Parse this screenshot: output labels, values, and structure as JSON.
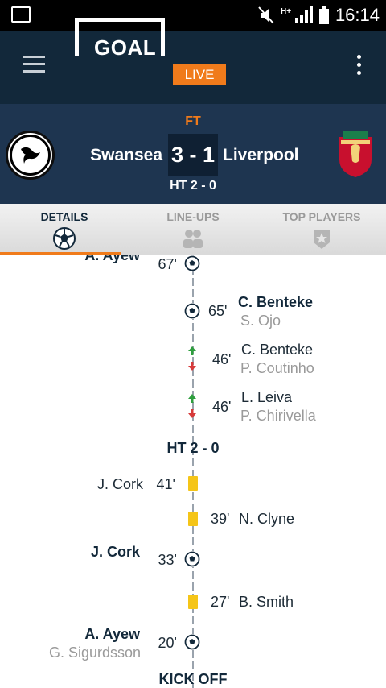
{
  "status_bar": {
    "time": "16:14",
    "icons": [
      "image-icon",
      "mute-icon",
      "hplus-signal-icon",
      "battery-icon"
    ]
  },
  "app_bar": {
    "logo_text": "GOAL",
    "live_label": "LIVE",
    "menu_icon": "hamburger-icon",
    "overflow_icon": "more-vert-icon"
  },
  "match": {
    "status": "FT",
    "home_team": "Swansea",
    "away_team": "Liverpool",
    "score": "3 - 1",
    "half_time": "HT 2 - 0",
    "home_crest": "swansea-crest-icon",
    "away_crest": "liverpool-crest-icon"
  },
  "tabs": [
    {
      "label": "DETAILS",
      "icon": "football-icon",
      "active": true
    },
    {
      "label": "LINE-UPS",
      "icon": "people-icon",
      "active": false
    },
    {
      "label": "TOP PLAYERS",
      "icon": "star-badge-icon",
      "active": false
    }
  ],
  "timeline": {
    "events": [
      {
        "side": "home",
        "type": "goal",
        "minute": "67'",
        "player": "A. Ayew",
        "assist": ""
      },
      {
        "side": "away",
        "type": "goal",
        "minute": "65'",
        "player": "C. Benteke",
        "assist": "S. Ojo"
      },
      {
        "side": "away",
        "type": "sub",
        "minute": "46'",
        "player_in": "C. Benteke",
        "player_out": "P. Coutinho"
      },
      {
        "side": "away",
        "type": "sub",
        "minute": "46'",
        "player_in": "L. Leiva",
        "player_out": "P. Chirivella"
      },
      {
        "side": "home",
        "type": "yellow",
        "minute": "41'",
        "player": "J. Cork"
      },
      {
        "side": "away",
        "type": "yellow",
        "minute": "39'",
        "player": "N. Clyne"
      },
      {
        "side": "home",
        "type": "goal",
        "minute": "33'",
        "player": "J. Cork",
        "assist": ""
      },
      {
        "side": "away",
        "type": "yellow",
        "minute": "27'",
        "player": "B. Smith"
      },
      {
        "side": "home",
        "type": "goal",
        "minute": "20'",
        "player": "A. Ayew",
        "assist": "G. Sigurdsson"
      }
    ],
    "ht_marker": "HT 2 - 0",
    "kickoff_label": "KICK OFF"
  },
  "colors": {
    "accent": "#f07b1b",
    "navy": "#12283a",
    "scorebar": "#1e3550",
    "yellow_card": "#f5c518"
  }
}
